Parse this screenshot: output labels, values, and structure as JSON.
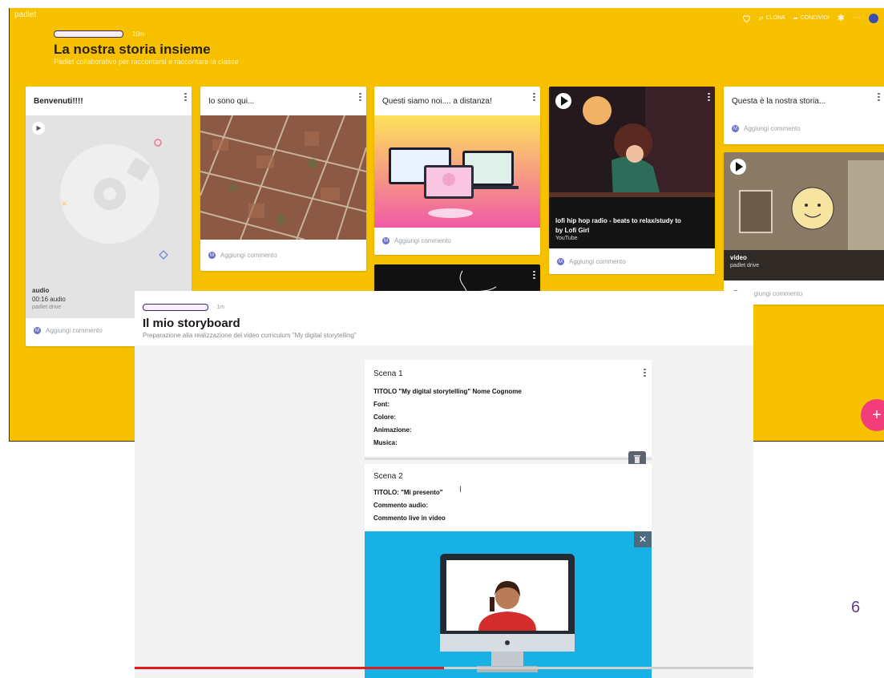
{
  "back_padlet": {
    "brand": "padlet",
    "toolbar": {
      "clone": "CLONA",
      "share": "CONDIVIDI"
    },
    "author_time": "10m",
    "title": "La nostra storia insieme",
    "subtitle": "Padlet collaborativo per raccontarsi e raccontare la classe",
    "comment_label": "Aggiungi commento",
    "comment_partial": "…ggiungi commento",
    "avatar_initial": "M",
    "colors": {
      "background": "#f7c100",
      "fab": "#f23d7a"
    },
    "cards": {
      "welcome": {
        "title": "Benvenuti!!!!",
        "media_title": "audio",
        "media_duration": "00:16 audio",
        "media_source": "padlet drive"
      },
      "here": {
        "title": "Io sono qui..."
      },
      "distance": {
        "title": "Questi siamo noi.... a distanza!"
      },
      "lofi": {
        "media_title": "lofi hip hop radio - beats to relax/study to",
        "media_author": "by Lofi Girl",
        "media_source": "YouTube"
      },
      "story": {
        "title": "Questa è la nostra storia..."
      },
      "video": {
        "media_title": "video",
        "media_source": "padlet drive"
      }
    }
  },
  "storyboard": {
    "author_time": "1m",
    "title": "Il mio storyboard",
    "subtitle": "Preparazione alla realizzazione del video curriculum \"My digital storytelling\"",
    "scenes": [
      {
        "title": "Scena 1",
        "lines": [
          "TITOLO \"My digital storytelling\" Nome Cognome",
          "Font:",
          "Colore:",
          "Animazione:",
          "Musica:"
        ]
      },
      {
        "title": "Scena 2",
        "lines": [
          "TITOLO: \"Mi presento\"",
          "Commento audio:",
          "Commento live in video"
        ]
      }
    ],
    "video_progress_percent": 50
  },
  "slide_number": "6"
}
